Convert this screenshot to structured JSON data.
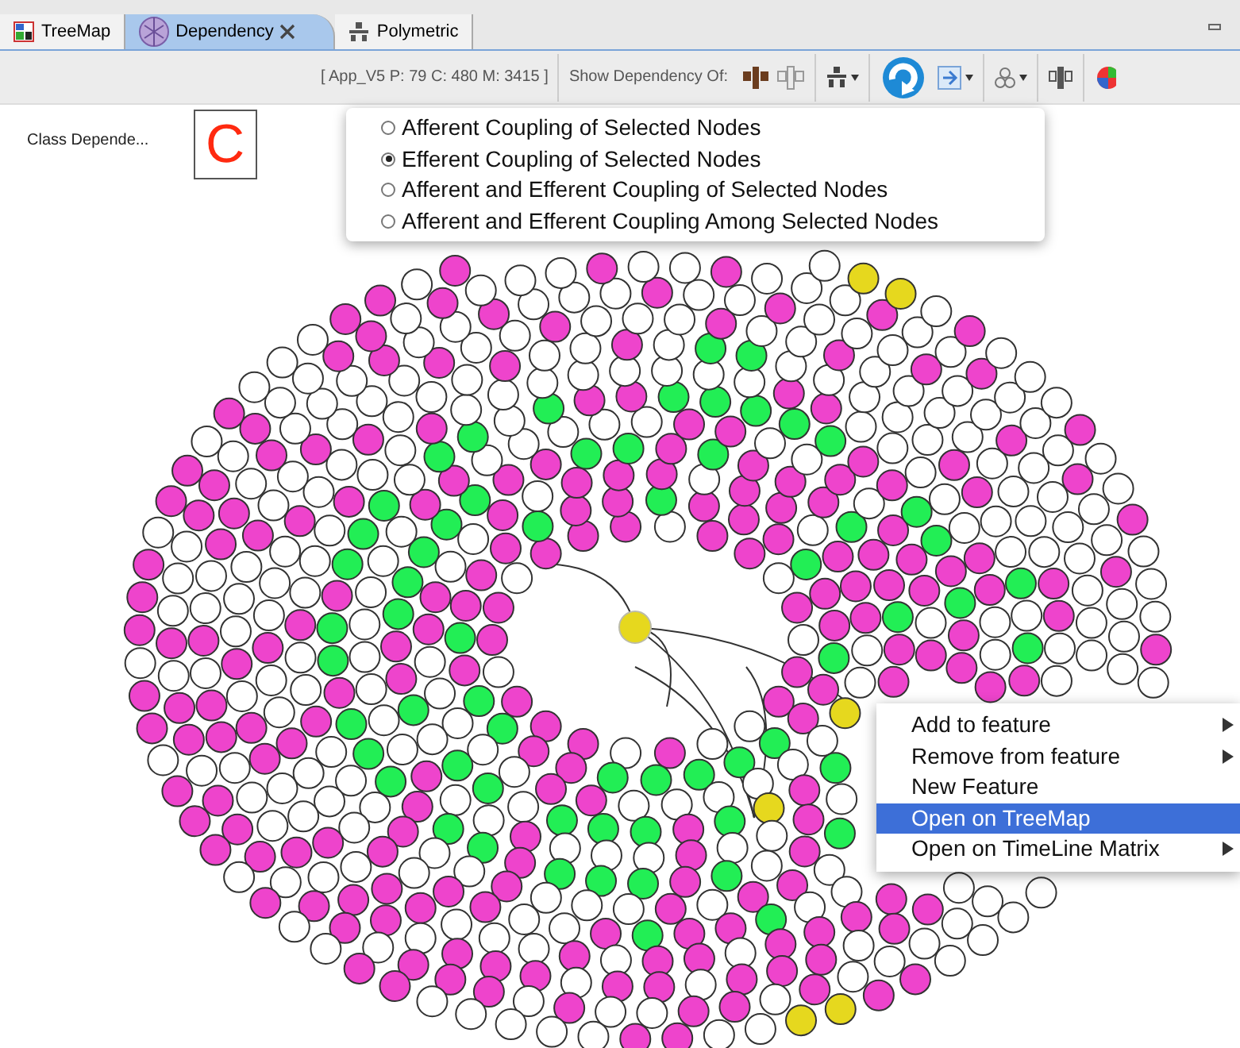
{
  "tabs": [
    {
      "label": "TreeMap",
      "selected": false,
      "closable": false
    },
    {
      "label": "Dependency",
      "selected": true,
      "closable": true
    },
    {
      "label": "Polymetric",
      "selected": false,
      "closable": false
    }
  ],
  "toolbar": {
    "project_info": "[ App_V5 P: 79 C: 480 M: 3415 ]",
    "show_dependency_label": "Show Dependency Of:"
  },
  "view_label": "Class Depende...",
  "letter_badge": "C",
  "dependency_menu": [
    {
      "label": "Afferent Coupling of Selected Nodes",
      "selected": false
    },
    {
      "label": "Efferent Coupling of Selected Nodes",
      "selected": true
    },
    {
      "label": "Afferent and Efferent Coupling of Selected Nodes",
      "selected": false
    },
    {
      "label": "Afferent and Efferent Coupling Among Selected Nodes",
      "selected": false
    }
  ],
  "context_menu": [
    {
      "label": "Add to feature",
      "submenu": true,
      "selected": false
    },
    {
      "label": "Remove from feature",
      "submenu": true,
      "selected": false
    },
    {
      "label": "New Feature",
      "submenu": false,
      "selected": false
    },
    {
      "label": "Open on TreeMap",
      "submenu": false,
      "selected": true
    },
    {
      "label": "Open on TimeLine Matrix",
      "submenu": true,
      "selected": false
    }
  ]
}
